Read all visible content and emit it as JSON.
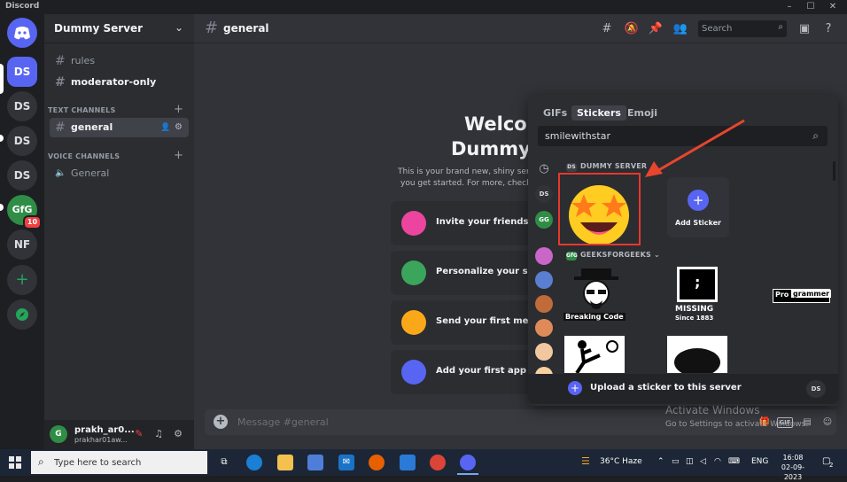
{
  "window": {
    "app_name": "Discord",
    "minimize": "–",
    "maximize": "☐",
    "close": "✕"
  },
  "servers": [
    {
      "abbr": "DS",
      "active": true
    },
    {
      "abbr": "DS"
    },
    {
      "abbr": "DS"
    },
    {
      "abbr": "DS"
    },
    {
      "abbr": "GfG",
      "badge": "10"
    },
    {
      "abbr": "NF"
    }
  ],
  "sidebar": {
    "server_name": "Dummy Server",
    "channels_top": [
      {
        "name": "rules"
      },
      {
        "name": "moderator-only"
      }
    ],
    "text_category": "TEXT CHANNELS",
    "text_channels": [
      {
        "name": "general"
      }
    ],
    "voice_category": "VOICE CHANNELS",
    "voice_channels": [
      {
        "name": "General"
      }
    ]
  },
  "user": {
    "display_name": "prakh_ar0...",
    "tag": "prakhar01aw..."
  },
  "header": {
    "channel": "general",
    "search_placeholder": "Search"
  },
  "welcome": {
    "line1": "Welcom",
    "line2": "Dummy S",
    "desc1": "This is your brand new, shiny server",
    "desc2": "you get started. For more, check ou",
    "cards": [
      {
        "label": "Invite your friends",
        "color": "#eb459f"
      },
      {
        "label": "Personalize your server w",
        "color": "#3ba55c"
      },
      {
        "label": "Send your first message",
        "color": "#faa81a"
      },
      {
        "label": "Add your first app",
        "color": "#5865f2"
      }
    ]
  },
  "composer": {
    "placeholder": "Message #general",
    "gif": "GIF"
  },
  "watermark": {
    "line1": "Activate Windows",
    "line2": "Go to Settings to activate Windows."
  },
  "picker": {
    "tabs": [
      {
        "label": "GIFs"
      },
      {
        "label": "Stickers",
        "active": true
      },
      {
        "label": "Emoji"
      }
    ],
    "search_value": "smilewithstar",
    "section1": {
      "abbr": "DS",
      "name": "DUMMY SERVER"
    },
    "add_sticker": "Add Sticker",
    "section2": {
      "abbr": "GfG",
      "name": "GEEKSFORGEEKS"
    },
    "gfg_stickers": {
      "s1_top": "Breaking Code",
      "s2_title": "MISSING",
      "s2_sub": "Since 1883",
      "s3_a": "Pro",
      "s3_b": "grammer"
    },
    "footer": "Upload a sticker to this server",
    "footer_abbr": "DS",
    "side_abbr": "DS"
  },
  "taskbar": {
    "search_placeholder": "Type here to search",
    "weather": "36°C  Haze",
    "lang": "ENG",
    "time": "16:08",
    "date": "02-09-2023",
    "notif": "2"
  },
  "colors": {
    "blurple": "#5865f2",
    "green": "#2f8d46",
    "red_highlight": "#e8382e",
    "arrow": "#e8452e"
  }
}
